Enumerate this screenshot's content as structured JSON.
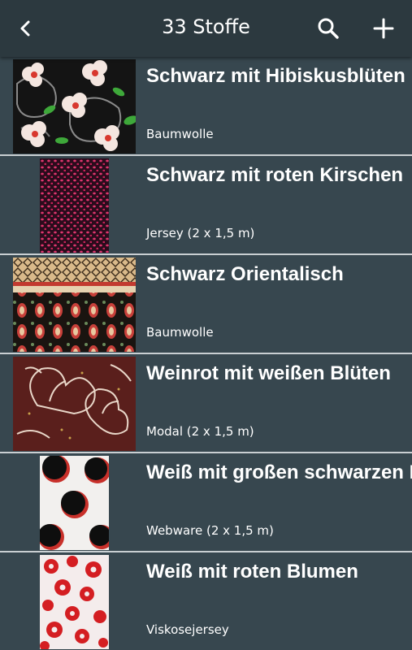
{
  "appbar": {
    "title": "33 Stoffe",
    "back_icon": "arrow-left-icon",
    "search_icon": "search-icon",
    "add_icon": "plus-icon"
  },
  "fabrics": [
    {
      "name": "Schwarz mit Hibiskusblüten",
      "material": "Baumwolle"
    },
    {
      "name": "Schwarz mit roten Kirschen",
      "material": "Jersey (2 x 1,5 m)"
    },
    {
      "name": "Schwarz Orientalisch",
      "material": "Baumwolle"
    },
    {
      "name": "Weinrot mit weißen Blüten",
      "material": "Modal (2 x 1,5 m)"
    },
    {
      "name": "Weiß mit großen schwarzen Punkten",
      "material": "Webware (2 x 1,5 m)"
    },
    {
      "name": "Weiß mit roten Blumen",
      "material": "Viskosejersey"
    }
  ]
}
